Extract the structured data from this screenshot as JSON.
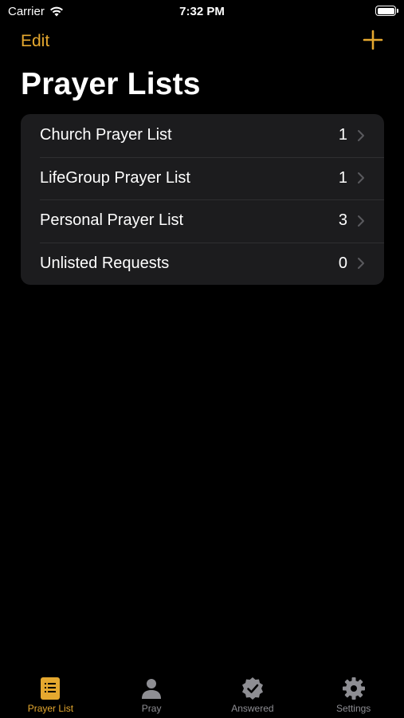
{
  "status_bar": {
    "carrier": "Carrier",
    "time": "7:32 PM"
  },
  "nav": {
    "edit_label": "Edit",
    "add_icon": "plus-icon"
  },
  "page_title": "Prayer Lists",
  "lists": [
    {
      "label": "Church Prayer List",
      "count": "1"
    },
    {
      "label": "LifeGroup Prayer List",
      "count": "1"
    },
    {
      "label": "Personal Prayer List",
      "count": "3"
    },
    {
      "label": "Unlisted Requests",
      "count": "0"
    }
  ],
  "tabs": [
    {
      "label": "Prayer List",
      "icon": "list-icon",
      "active": true
    },
    {
      "label": "Pray",
      "icon": "person-icon",
      "active": false
    },
    {
      "label": "Answered",
      "icon": "checkmark-seal-icon",
      "active": false
    },
    {
      "label": "Settings",
      "icon": "gear-icon",
      "active": false
    }
  ],
  "colors": {
    "accent": "#e5a82f",
    "background": "#000000",
    "card": "#1c1c1e",
    "inactive": "#8e8e93"
  }
}
